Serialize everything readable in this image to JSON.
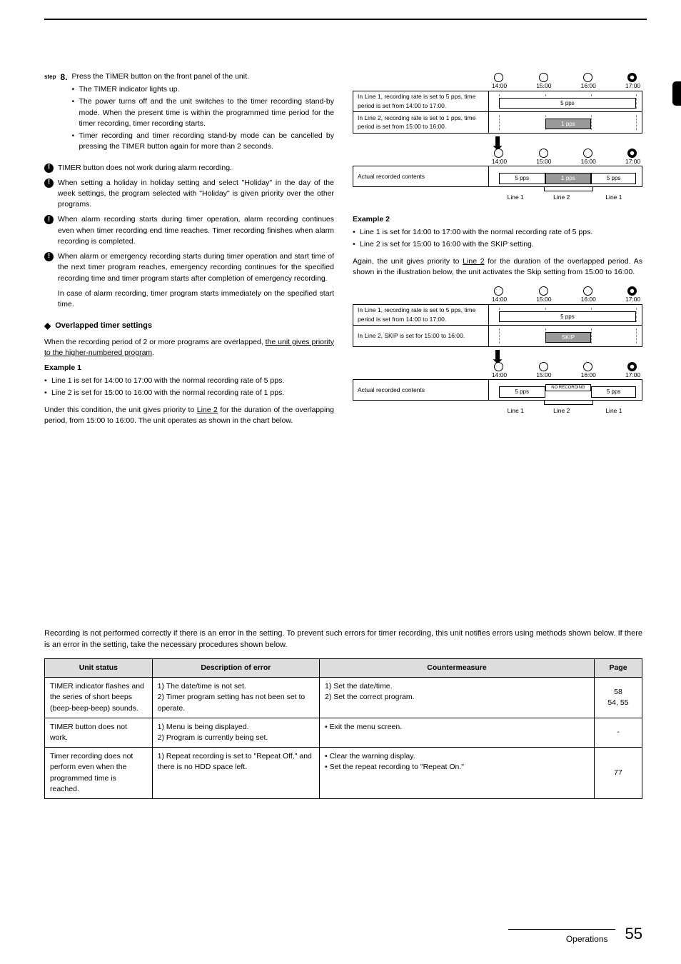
{
  "step": {
    "label": "step",
    "num": "8.",
    "text": "Press the TIMER button on the front panel of the unit."
  },
  "step_bullets": [
    "The TIMER indicator lights up.",
    "The power turns off and the unit switches to the timer recording stand-by mode. When the present time is within the programmed time period for the timer recording, timer recording starts.",
    "Timer recording and timer recording stand-by mode can be cancelled by pressing the TIMER button again for more than 2 seconds."
  ],
  "notes": [
    "TIMER button does not work during alarm recording.",
    "When setting a holiday in holiday setting and select \"Holiday\" in the day of the week settings, the program selected with \"Holiday\" is given priority over the other programs.",
    "When alarm recording starts during timer operation, alarm recording continues even when timer recording end time reaches. Timer recording finishes when alarm recording is completed.",
    "When alarm or emergency recording starts during timer operation and start time of the next timer program reaches, emergency recording continues for the specified recording time and timer program starts after completion of emergency recording."
  ],
  "note_tail": "In case of alarm recording, timer program starts immediately on the specified start time.",
  "overlap_heading": "Overlapped timer settings",
  "overlap_intro_a": "When the recording period of 2 or more programs are overlapped, ",
  "overlap_intro_u": "the unit gives priority to the higher-numbered program",
  "overlap_intro_b": ".",
  "ex1_title": "Example 1",
  "ex1_b1": "Line 1 is set for 14:00 to 17:00 with the normal recording rate of 5 pps.",
  "ex1_b2": "Line 2 is set for 15:00 to 16:00 with the normal recording rate of 1 pps.",
  "ex1_p_a": "Under this condition, the unit gives priority to ",
  "ex1_p_u": "Line 2",
  "ex1_p_b": " for the duration of the overlapping period, from 15:00 to 16:00. The unit operates as shown in the chart below.",
  "chart_data": [
    {
      "ticks": [
        "14:00",
        "15:00",
        "16:00",
        "17:00"
      ],
      "rows_top": [
        {
          "label": "In Line 1, recording rate is set to 5 pps, time period is set from 14:00 to 17:00.",
          "bar": {
            "text": "5 pps",
            "from": 0,
            "to": 3,
            "shade": false
          }
        },
        {
          "label": "In Line 2, recording rate is set to 1 pps, time period is set from 15:00 to 16:00.",
          "bar": {
            "text": "1 pps",
            "from": 1,
            "to": 2,
            "shade": true
          }
        }
      ],
      "rows_bottom": {
        "label": "Actual recorded contents",
        "bars": [
          {
            "text": "5 pps",
            "from": 0,
            "to": 1,
            "shade": false
          },
          {
            "text": "1 pps",
            "from": 1,
            "to": 2,
            "shade": true
          },
          {
            "text": "5 pps",
            "from": 2,
            "to": 3,
            "shade": false
          }
        ]
      },
      "line_labels": {
        "line1": "Line 1",
        "line2": "Line 2"
      }
    },
    {
      "ticks": [
        "14:00",
        "15:00",
        "16:00",
        "17:00"
      ],
      "rows_top": [
        {
          "label": "In Line 1, recording rate is set to 5 pps, time period is set from 14:00 to 17:00.",
          "bar": {
            "text": "5 pps",
            "from": 0,
            "to": 3,
            "shade": false
          }
        },
        {
          "label": "In Line 2, SKIP is set for 15:00 to 16:00.",
          "bar": {
            "text": "SKIP",
            "from": 1,
            "to": 2,
            "shade": true
          }
        }
      ],
      "rows_bottom": {
        "label": "Actual recorded contents",
        "bars": [
          {
            "text": "5 pps",
            "from": 0,
            "to": 1,
            "shade": false
          },
          {
            "text": "NO RECORDING",
            "from": 1,
            "to": 2,
            "shade": false,
            "small": true
          },
          {
            "text": "5 pps",
            "from": 2,
            "to": 3,
            "shade": false
          }
        ]
      },
      "line_labels": {
        "line1": "Line 1",
        "line2": "Line 2"
      }
    }
  ],
  "ex2_title": "Example 2",
  "ex2_b1": "Line 1 is set for 14:00 to 17:00 with the normal recording rate of 5 pps.",
  "ex2_b2": "Line 2 is set for 15:00 to 16:00 with the SKIP setting.",
  "ex2_p_a": "Again, the unit gives priority to ",
  "ex2_p_u": "Line 2",
  "ex2_p_b": " for the duration of the overlapped period. As shown in the illustration below, the unit activates the Skip setting from 15:00 to 16:00.",
  "err_intro": "Recording is not performed correctly if there is an error in the setting. To prevent such errors for timer recording, this unit notifies errors using methods shown below. If there is an error in the setting, take the necessary procedures shown below.",
  "table": {
    "headers": [
      "Unit status",
      "Description of error",
      "Countermeasure",
      "Page"
    ],
    "rows": [
      {
        "status": "TIMER indicator flashes and the series of short beeps (beep-beep-beep) sounds.",
        "desc": "1) The date/time is not set.\n2) Timer program setting has not been set to operate.",
        "counter": "1) Set the date/time.\n2) Set the correct program.",
        "page": "58\n54, 55"
      },
      {
        "status": "TIMER button does not work.",
        "desc": "1) Menu is being displayed.\n2) Program is currently being set.",
        "counter": "•   Exit the menu screen.",
        "page": "-"
      },
      {
        "status": "Timer recording does not perform even when the programmed time is reached.",
        "desc": "1) Repeat recording is set to \"Repeat Off,\" and there is no HDD space left.",
        "counter": "•   Clear the warning display.\n•   Set the repeat recording to \"Repeat On.\"",
        "page": "77"
      }
    ]
  },
  "footer": {
    "ops": "Operations",
    "page": "55"
  }
}
